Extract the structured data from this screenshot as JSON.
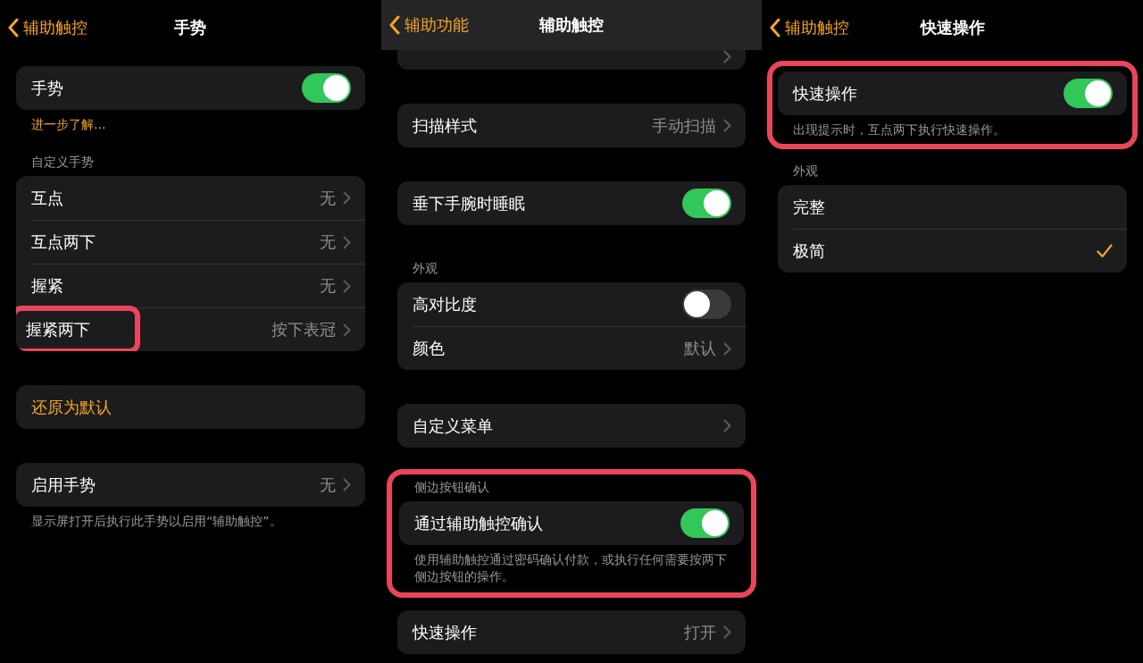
{
  "panels": [
    {
      "back": "辅助触控",
      "title": "手势",
      "scrolled": false,
      "blocks": [
        {
          "kind": "group",
          "highlighted": false,
          "rows": [
            {
              "kind": "toggle",
              "label": "手势",
              "on": true,
              "highlighted": false
            }
          ],
          "footer": {
            "kind": "link",
            "text": "进一步了解..."
          }
        },
        {
          "kind": "group",
          "highlighted": false,
          "header": "自定义手势",
          "rows": [
            {
              "kind": "value",
              "label": "互点",
              "value": "无",
              "highlighted": false
            },
            {
              "kind": "value",
              "label": "互点两下",
              "value": "无",
              "highlighted": false
            },
            {
              "kind": "value",
              "label": "握紧",
              "value": "无",
              "highlighted": false
            },
            {
              "kind": "value",
              "label": "握紧两下",
              "value": "按下表冠",
              "highlighted": true
            }
          ]
        },
        {
          "kind": "group",
          "highlighted": false,
          "rows": [
            {
              "kind": "action",
              "label": "还原为默认",
              "highlighted": false
            }
          ]
        },
        {
          "kind": "group",
          "highlighted": false,
          "rows": [
            {
              "kind": "value",
              "label": "启用手势",
              "value": "无",
              "highlighted": false
            }
          ],
          "footer": {
            "kind": "note",
            "text": "显示屏打开后执行此手势以启用“辅助触控”。"
          }
        }
      ]
    },
    {
      "back": "辅助功能",
      "title": "辅助触控",
      "scrolled": true,
      "blocks": [
        {
          "kind": "cut-off",
          "highlighted": false
        },
        {
          "kind": "group",
          "highlighted": false,
          "rows": [
            {
              "kind": "value",
              "label": "扫描样式",
              "value": "手动扫描",
              "highlighted": false
            }
          ]
        },
        {
          "kind": "group",
          "highlighted": false,
          "rows": [
            {
              "kind": "toggle",
              "label": "垂下手腕时睡眠",
              "on": true,
              "highlighted": false
            }
          ]
        },
        {
          "kind": "group",
          "highlighted": false,
          "header": "外观",
          "rows": [
            {
              "kind": "toggle",
              "label": "高对比度",
              "on": false,
              "highlighted": false
            },
            {
              "kind": "value",
              "label": "颜色",
              "value": "默认",
              "highlighted": false
            }
          ]
        },
        {
          "kind": "group",
          "highlighted": false,
          "rows": [
            {
              "kind": "link",
              "label": "自定义菜单",
              "highlighted": false
            }
          ]
        },
        {
          "kind": "group",
          "highlighted": true,
          "header": "侧边按钮确认",
          "rows": [
            {
              "kind": "toggle",
              "label": "通过辅助触控确认",
              "on": true,
              "highlighted": false
            }
          ],
          "footer": {
            "kind": "note",
            "text": "使用辅助触控通过密码确认付款，或执行任何需要按两下侧边按钮的操作。"
          }
        },
        {
          "kind": "group",
          "highlighted": false,
          "rows": [
            {
              "kind": "value",
              "label": "快速操作",
              "value": "打开",
              "highlighted": false
            }
          ]
        }
      ]
    },
    {
      "back": "辅助触控",
      "title": "快速操作",
      "scrolled": false,
      "blocks": [
        {
          "kind": "group",
          "highlighted": true,
          "rows": [
            {
              "kind": "toggle",
              "label": "快速操作",
              "on": true,
              "highlighted": false
            }
          ],
          "footer": {
            "kind": "note",
            "text": "出现提示时，互点两下执行快速操作。"
          }
        },
        {
          "kind": "group",
          "highlighted": false,
          "header": "外观",
          "rows": [
            {
              "kind": "choice",
              "label": "完整",
              "selected": false,
              "highlighted": false
            },
            {
              "kind": "choice",
              "label": "极简",
              "selected": true,
              "highlighted": false
            }
          ]
        }
      ]
    }
  ]
}
